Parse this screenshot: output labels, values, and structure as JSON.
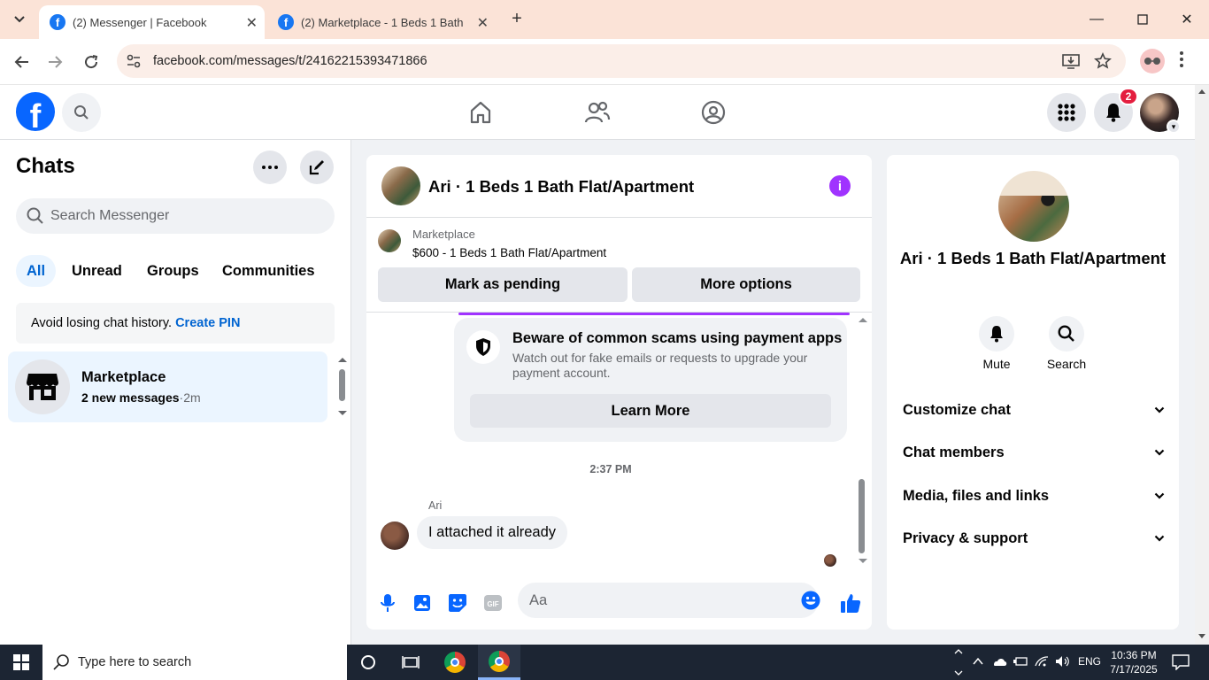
{
  "browser": {
    "tabs": [
      {
        "title": "(2) Messenger | Facebook",
        "active": true
      },
      {
        "title": "(2) Marketplace - 1 Beds 1 Bath",
        "active": false
      }
    ],
    "url": "facebook.com/messages/t/24162215393471866"
  },
  "fb_header": {
    "logo": "f",
    "notification_count": "2"
  },
  "sidebar": {
    "title": "Chats",
    "search_placeholder": "Search Messenger",
    "filters": [
      "All",
      "Unread",
      "Groups",
      "Communities"
    ],
    "active_filter": "All",
    "pin_notice": {
      "text": "Avoid losing chat history. ",
      "link": "Create PIN"
    },
    "chats": [
      {
        "name": "Marketplace",
        "preview": "2 new messages",
        "separator": "·",
        "time": "2m"
      }
    ]
  },
  "conversation": {
    "title": "Ari · 1 Beds 1 Bath Flat/Apartment",
    "marketplace_label": "Marketplace",
    "listing": "$600 - 1 Beds 1 Bath Flat/Apartment",
    "buttons": {
      "pending": "Mark as pending",
      "more": "More options"
    },
    "scam_card": {
      "title": "Beware of common scams using payment apps",
      "body": "Watch out for fake emails or requests to upgrade your payment account.",
      "button": "Learn More"
    },
    "timestamp": "2:37 PM",
    "messages": [
      {
        "sender": "Ari",
        "text": "I attached it already"
      }
    ],
    "composer_placeholder": "Aa"
  },
  "info_panel": {
    "name": "Ari · 1 Beds 1 Bath Flat/Apartment",
    "actions": [
      {
        "label": "Mute",
        "icon": "bell-icon"
      },
      {
        "label": "Search",
        "icon": "search-icon"
      }
    ],
    "sections": [
      "Customize chat",
      "Chat members",
      "Media, files and links",
      "Privacy & support"
    ]
  },
  "taskbar": {
    "search_placeholder": "Type here to search",
    "language": "ENG",
    "time": "10:36 PM",
    "date": "7/17/2025"
  },
  "colors": {
    "fb_blue": "#0866ff",
    "link_blue": "#0064d1",
    "messenger_purple": "#a033ff",
    "badge_red": "#e41e3f",
    "tab_bar": "#fbe3d7"
  }
}
